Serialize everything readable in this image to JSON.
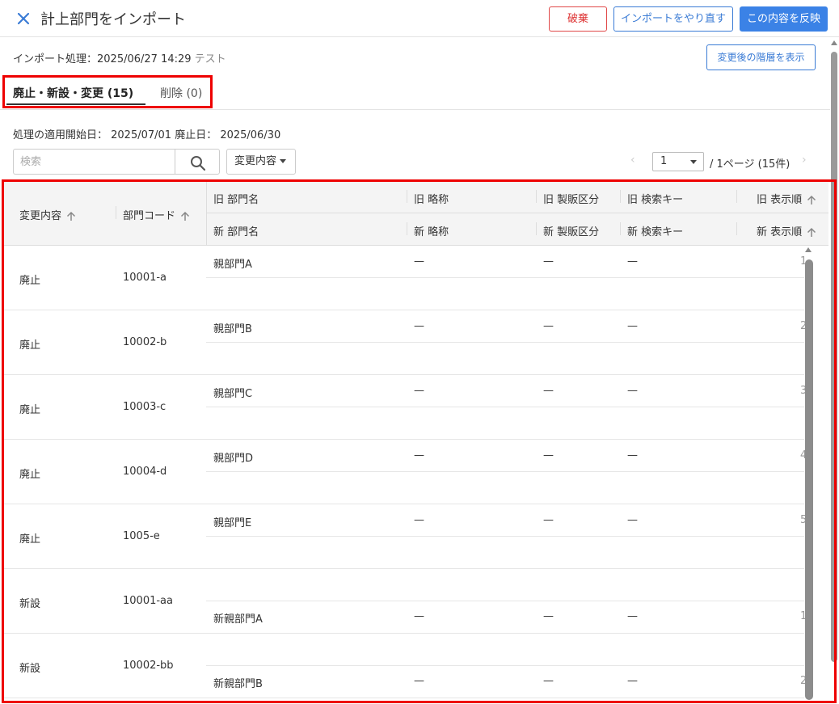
{
  "header": {
    "title": "計上部門をインポート",
    "discard_label": "破棄",
    "redo_label": "インポートをやり直す",
    "apply_label": "この内容を反映"
  },
  "import_info": {
    "label": "インポート処理：2025/06/27 14:29",
    "note": "テスト",
    "show_hierarchy_label": "変更後の階層を表示"
  },
  "tabs": {
    "changes_label": "廃止・新設・変更 (15)",
    "delete_label": "削除 (0)"
  },
  "dates_text": "処理の適用開始日： 2025/07/01  廃止日： 2025/06/30",
  "search": {
    "placeholder": "検索",
    "filter_label": "変更内容"
  },
  "pagination": {
    "prev": "‹",
    "page_value": "1",
    "page_text": "/  1ページ (15件)",
    "next": "›"
  },
  "table": {
    "headers": {
      "change": "変更内容",
      "code": "部門コード",
      "old_name": "旧 部門名",
      "old_abbr": "旧 略称",
      "old_sales": "旧 製販区分",
      "old_key": "旧 検索キー",
      "old_order": "旧 表示順",
      "new_name": "新 部門名",
      "new_abbr": "新 略称",
      "new_sales": "新 製販区分",
      "new_key": "新 検索キー",
      "new_order": "新 表示順"
    },
    "rows": [
      {
        "change": "廃止",
        "code": "10001-a",
        "old_name": "親部門A",
        "old_abbr": "—",
        "old_sales": "—",
        "old_key": "—",
        "old_order": "1",
        "new_name": "",
        "new_abbr": "",
        "new_sales": "",
        "new_key": "",
        "new_order": ""
      },
      {
        "change": "廃止",
        "code": "10002-b",
        "old_name": "親部門B",
        "old_abbr": "—",
        "old_sales": "—",
        "old_key": "—",
        "old_order": "2",
        "new_name": "",
        "new_abbr": "",
        "new_sales": "",
        "new_key": "",
        "new_order": ""
      },
      {
        "change": "廃止",
        "code": "10003-c",
        "old_name": "親部門C",
        "old_abbr": "—",
        "old_sales": "—",
        "old_key": "—",
        "old_order": "3",
        "new_name": "",
        "new_abbr": "",
        "new_sales": "",
        "new_key": "",
        "new_order": ""
      },
      {
        "change": "廃止",
        "code": "10004-d",
        "old_name": "親部門D",
        "old_abbr": "—",
        "old_sales": "—",
        "old_key": "—",
        "old_order": "4",
        "new_name": "",
        "new_abbr": "",
        "new_sales": "",
        "new_key": "",
        "new_order": ""
      },
      {
        "change": "廃止",
        "code": "1005-e",
        "old_name": "親部門E",
        "old_abbr": "—",
        "old_sales": "—",
        "old_key": "—",
        "old_order": "5",
        "new_name": "",
        "new_abbr": "",
        "new_sales": "",
        "new_key": "",
        "new_order": ""
      },
      {
        "change": "新設",
        "code": "10001-aa",
        "old_name": "",
        "old_abbr": "",
        "old_sales": "",
        "old_key": "",
        "old_order": "",
        "new_name": "新親部門A",
        "new_abbr": "—",
        "new_sales": "—",
        "new_key": "—",
        "new_order": "1"
      },
      {
        "change": "新設",
        "code": "10002-bb",
        "old_name": "",
        "old_abbr": "",
        "old_sales": "",
        "old_key": "",
        "old_order": "",
        "new_name": "新親部門B",
        "new_abbr": "—",
        "new_sales": "—",
        "new_key": "—",
        "new_order": "2"
      }
    ]
  },
  "colors": {
    "accent": "#3b82e6",
    "danger": "#e04848",
    "highlight": "#ee0000",
    "header_bg": "#f4f4f4"
  },
  "icons": {
    "close": "close-icon",
    "search": "search-icon",
    "sort": "sort-up-arrow-icon"
  }
}
